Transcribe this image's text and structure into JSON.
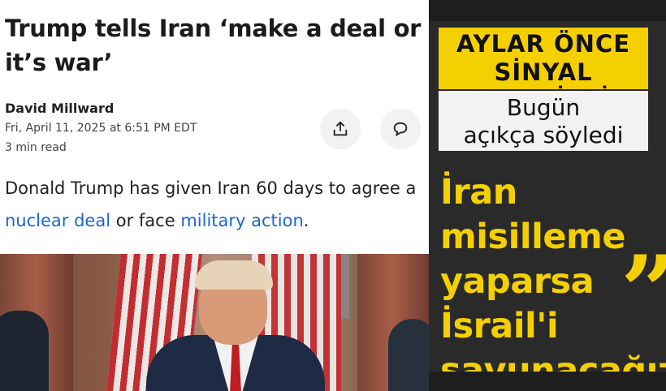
{
  "article": {
    "headline": "Trump tells Iran ‘make a deal or it’s war’",
    "author": "David Millward",
    "date": "Fri, April 11, 2025 at 6:51 PM EDT",
    "read_time": "3 min read",
    "lede_prefix": "Donald Trump has given Iran 60 days to agree a ",
    "link1": "nuclear deal",
    "lede_middle": " or face ",
    "link2": "military action",
    "lede_suffix": ".",
    "share_icon": "share-icon",
    "comment_icon": "comment-icon",
    "link_color": "#1a66d1"
  },
  "overlay": {
    "yellow_line1": "AYLAR ÖNCE",
    "yellow_line2": "SİNYAL VERMİŞTİ",
    "white_line1": "Bugün",
    "white_line2": "açıkça söyledi",
    "quote_lines": [
      "İran",
      "misilleme",
      "yaparsa",
      "İsrail'i",
      "savunacağız"
    ],
    "quote_mark": "”",
    "accent_color": "#f5d000"
  }
}
